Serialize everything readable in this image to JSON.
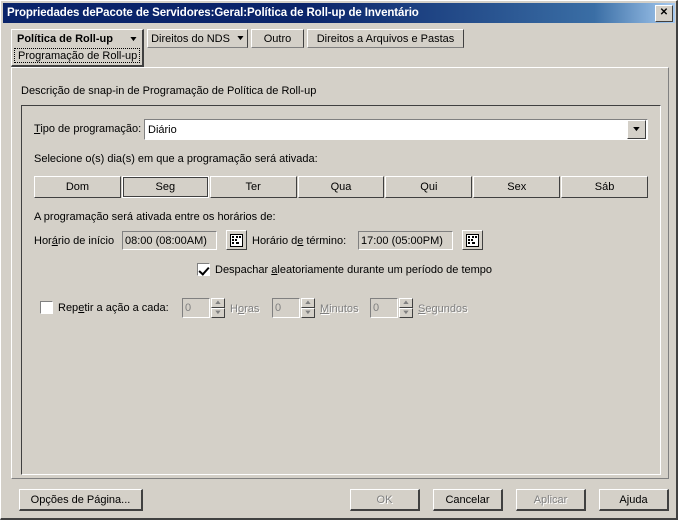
{
  "window": {
    "title": "Propriedades dePacote de Servidores:Geral:Política de Roll-up de Inventário",
    "close_label": "✕"
  },
  "tabs": {
    "active": {
      "label": "Política de Roll-up",
      "arrow": "▼",
      "subitem": "Programação de Roll-up"
    },
    "others": [
      {
        "label": "Direitos do NDS",
        "arrow": "▼",
        "has_arrow": true
      },
      {
        "label": "Outro",
        "has_arrow": false
      },
      {
        "label": "Direitos a Arquivos e Pastas",
        "has_arrow": false
      }
    ]
  },
  "panel": {
    "description": "Descrição de snap-in de Programação de Política de Roll-up",
    "schedule_type_label": "Tipo de programação:",
    "schedule_type_value": "Diário",
    "schedule_type_arrow": "▼",
    "days_label": "Selecione o(s) dia(s) em que a programação será ativada:",
    "days": [
      {
        "label": "Dom",
        "selected": false
      },
      {
        "label": "Seg",
        "selected": true
      },
      {
        "label": "Ter",
        "selected": false
      },
      {
        "label": "Qua",
        "selected": false
      },
      {
        "label": "Qui",
        "selected": false
      },
      {
        "label": "Sex",
        "selected": false
      },
      {
        "label": "Sáb",
        "selected": false
      }
    ],
    "time_range_label": "A programação será ativada entre os horários de:",
    "start_time_label": "Horário de início",
    "start_time_value": "08:00 (08:00AM)",
    "end_time_label": "Horário de término:",
    "end_time_value": "17:00 (05:00PM)",
    "random_checkbox": {
      "label": "Despachar aleatoriamente durante um período de tempo",
      "checked": true
    },
    "repeat_checkbox": {
      "label": "Repetir a ação a cada:",
      "checked": false
    },
    "repeat_fields": [
      {
        "value": "0",
        "unit": "Horas"
      },
      {
        "value": "0",
        "unit": "Minutos"
      },
      {
        "value": "0",
        "unit": "Segundos"
      }
    ],
    "spin_up": "▲",
    "spin_down": "▼"
  },
  "footer": {
    "page_options": "Opções de Página...",
    "ok": "OK",
    "cancel": "Cancelar",
    "apply": "Aplicar",
    "help": "Ajuda"
  },
  "colors": {
    "titlebar_start": "#0a246a",
    "titlebar_end": "#a6caf0",
    "face": "#d4d0c8",
    "field": "#ffffff",
    "disabled_text": "#808080"
  }
}
